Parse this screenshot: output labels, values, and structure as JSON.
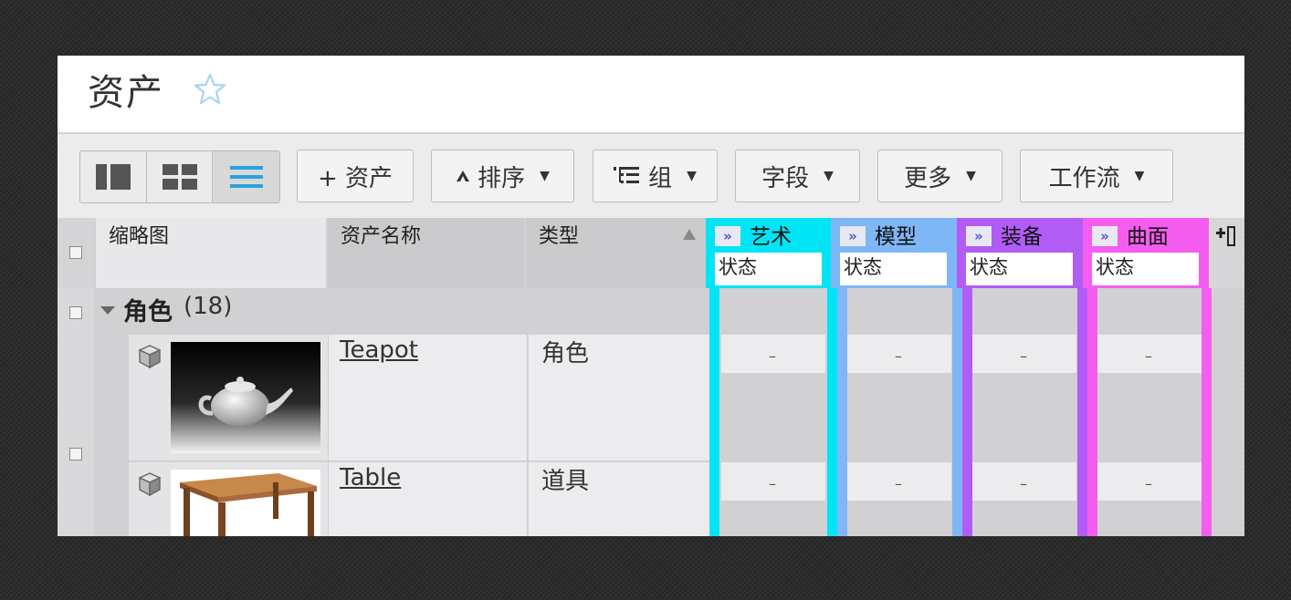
{
  "page": {
    "title": "资产",
    "favorite_icon": "star-icon"
  },
  "toolbar": {
    "view_modes": [
      {
        "icon": "list-detail-icon",
        "selected": false
      },
      {
        "icon": "grid-icon",
        "selected": false
      },
      {
        "icon": "list-icon",
        "selected": true
      }
    ],
    "add_asset_label": "+ 资产",
    "sort_label": "排序",
    "group_label": "组",
    "fields_label": "字段",
    "more_label": "更多",
    "workflow_label": "工作流"
  },
  "columns": {
    "thumbnail": "缩略图",
    "asset_name": "资产名称",
    "type": "类型",
    "add_column_icon": "add-column-icon"
  },
  "stages": [
    {
      "name": "艺术",
      "sub": "状态",
      "expand": "»",
      "color": "#00e5f5"
    },
    {
      "name": "模型",
      "sub": "状态",
      "expand": "»",
      "color": "#7eb6f6"
    },
    {
      "name": "装备",
      "sub": "状态",
      "expand": "»",
      "color": "#b15cf5"
    },
    {
      "name": "曲面",
      "sub": "状态",
      "expand": "»",
      "color": "#f55cf0"
    }
  ],
  "group": {
    "name": "角色",
    "count": "(18)"
  },
  "rows": [
    {
      "name": "Teapot",
      "type": "角色",
      "thumbnail": "teapot-thumbnail",
      "stages": [
        "–",
        "–",
        "–",
        "–"
      ]
    },
    {
      "name": "Table",
      "type": "道具",
      "thumbnail": "table-thumbnail",
      "stages": [
        "–",
        "–",
        "–",
        "–"
      ]
    }
  ]
}
